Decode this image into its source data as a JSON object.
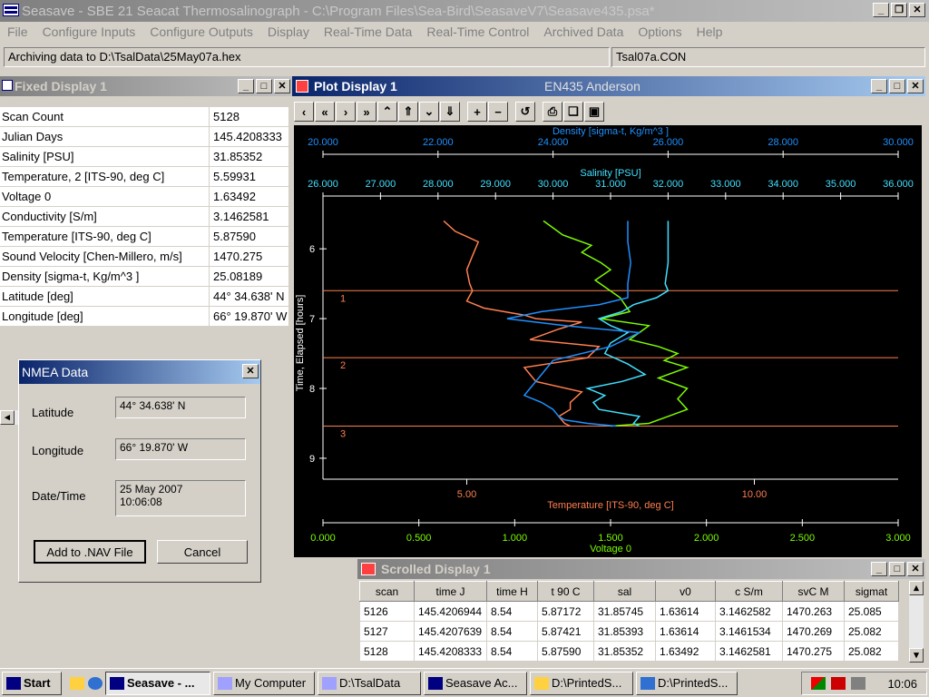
{
  "main_window": {
    "title": "Seasave - SBE 21 Seacat Thermosalinograph - C:\\Program Files\\Sea-Bird\\SeasaveV7\\Seasave435.psa*",
    "menu": [
      "File",
      "Configure Inputs",
      "Configure Outputs",
      "Display",
      "Real-Time Data",
      "Real-Time Control",
      "Archived Data",
      "Options",
      "Help"
    ],
    "archive_status": "Archiving data to D:\\TsalData\\25May07a.hex",
    "con_file": "Tsal07a.CON"
  },
  "fixed_display": {
    "title": "Fixed Display 1",
    "rows": [
      {
        "label": "Scan Count",
        "value": "5128"
      },
      {
        "label": "Julian Days",
        "value": "145.4208333"
      },
      {
        "label": "Salinity [PSU]",
        "value": "31.85352"
      },
      {
        "label": "Temperature, 2 [ITS-90, deg C]",
        "value": "5.59931"
      },
      {
        "label": "Voltage 0",
        "value": "1.63492"
      },
      {
        "label": "Conductivity [S/m]",
        "value": "3.1462581"
      },
      {
        "label": "Temperature [ITS-90, deg C]",
        "value": "5.87590"
      },
      {
        "label": "Sound Velocity [Chen-Millero, m/s]",
        "value": "1470.275"
      },
      {
        "label": "Density [sigma-t, Kg/m^3 ]",
        "value": "25.08189"
      },
      {
        "label": "Latitude [deg]",
        "value": " 44° 34.638' N"
      },
      {
        "label": "Longitude [deg]",
        "value": " 66° 19.870' W"
      }
    ]
  },
  "nmea_dialog": {
    "title": "NMEA Data",
    "latitude_label": "Latitude",
    "latitude_value": "44° 34.638' N",
    "longitude_label": "Longitude",
    "longitude_value": "66° 19.870' W",
    "datetime_label": "Date/Time",
    "date_value": "25 May 2007",
    "time_value": "10:06:08",
    "add_button": "Add to .NAV File",
    "cancel_button": "Cancel"
  },
  "plot_display": {
    "title": "Plot Display 1",
    "subtitle": "EN435 Anderson"
  },
  "chart_data": {
    "type": "line",
    "top_axis_1": {
      "label": "Density [sigma-t, Kg/m^3 ]",
      "ticks": [
        "20.000",
        "22.000",
        "24.000",
        "26.000",
        "28.000",
        "30.000"
      ],
      "range": [
        20,
        30
      ],
      "color": "#1e90ff"
    },
    "top_axis_2": {
      "label": "Salinity [PSU]",
      "ticks": [
        "26.000",
        "27.000",
        "28.000",
        "29.000",
        "30.000",
        "31.000",
        "32.000",
        "33.000",
        "34.000",
        "35.000",
        "36.000"
      ],
      "range": [
        26,
        36
      ],
      "color": "#40e0ff"
    },
    "left_axis": {
      "label": "Time, Elapsed [hours]",
      "ticks": [
        "6",
        "7",
        "8",
        "9"
      ],
      "range": [
        5.4,
        9.3
      ]
    },
    "bottom_axis_1": {
      "label": "Temperature [ITS-90, deg C]",
      "ticks": [
        "5.00",
        "10.00"
      ],
      "range": [
        2.5,
        12.5
      ],
      "color": "#ff7f50"
    },
    "bottom_axis_2": {
      "label": "Voltage 0",
      "ticks": [
        "0.000",
        "0.500",
        "1.000",
        "1.500",
        "2.000",
        "2.500",
        "3.000"
      ],
      "range": [
        0,
        3
      ],
      "color": "#7cfc00"
    },
    "markers": [
      {
        "label": "1",
        "time": 6.6
      },
      {
        "label": "2",
        "time": 7.56
      },
      {
        "label": "3",
        "time": 8.54
      }
    ],
    "series": [
      {
        "color": "#ff7f50",
        "axis": "temperature",
        "x": [
          4.6,
          4.8,
          5.2,
          5.1,
          5.0,
          5.05,
          5.1,
          5.0,
          5.3,
          6.0,
          6.2,
          7.0,
          6.6,
          6.1,
          7.3,
          7.1,
          6.0,
          6.2,
          7.0,
          6.8,
          6.8,
          6.6,
          6.7,
          6.8
        ],
        "y": [
          5.6,
          5.75,
          5.9,
          6.1,
          6.3,
          6.5,
          6.6,
          6.75,
          6.85,
          6.95,
          7.0,
          7.05,
          7.15,
          7.3,
          7.4,
          7.56,
          7.7,
          7.9,
          8.05,
          8.2,
          8.3,
          8.4,
          8.5,
          8.54
        ]
      },
      {
        "color": "#7cfc00",
        "axis": "voltage",
        "x": [
          1.15,
          1.25,
          1.4,
          1.35,
          1.45,
          1.5,
          1.42,
          1.55,
          1.6,
          1.45,
          1.7,
          1.6,
          1.75,
          1.85,
          1.78,
          1.9,
          1.75,
          1.9,
          1.85,
          1.9,
          1.8,
          1.7,
          1.5
        ],
        "y": [
          5.6,
          5.8,
          5.95,
          6.05,
          6.2,
          6.3,
          6.45,
          6.7,
          6.9,
          7.0,
          7.1,
          7.3,
          7.4,
          7.5,
          7.6,
          7.7,
          7.85,
          8.0,
          8.15,
          8.3,
          8.4,
          8.5,
          8.54
        ]
      },
      {
        "color": "#40e0ff",
        "axis": "salinity",
        "x": [
          32.0,
          32.0,
          32.0,
          31.95,
          32.0,
          31.8,
          31.4,
          31.2,
          30.8,
          31.0,
          31.3,
          31.0,
          30.9,
          31.3,
          31.6,
          31.2,
          30.6,
          30.9,
          30.7,
          30.8,
          31.5,
          31.4,
          31.5
        ],
        "y": [
          5.6,
          5.9,
          6.2,
          6.5,
          6.6,
          6.7,
          6.8,
          6.9,
          7.0,
          7.1,
          7.2,
          7.35,
          7.5,
          7.65,
          7.8,
          7.9,
          8.0,
          8.1,
          8.2,
          8.3,
          8.4,
          8.5,
          8.54
        ]
      },
      {
        "color": "#1e90ff",
        "axis": "density",
        "x": [
          25.3,
          25.3,
          25.35,
          25.3,
          25.3,
          25.3,
          24.8,
          23.8,
          23.2,
          24.2,
          25.5,
          25.0,
          24.0,
          23.8,
          23.6,
          23.5,
          23.8,
          24.0,
          24.1,
          24.2,
          24.6,
          25.1
        ],
        "y": [
          5.6,
          5.9,
          6.2,
          6.5,
          6.6,
          6.7,
          6.8,
          6.9,
          7.0,
          7.1,
          7.2,
          7.4,
          7.6,
          7.8,
          8.0,
          8.1,
          8.2,
          8.3,
          8.4,
          8.45,
          8.5,
          8.54
        ]
      }
    ]
  },
  "scrolled_display": {
    "title": "Scrolled Display 1",
    "columns": [
      "scan",
      "time J",
      "time H",
      "t 90 C",
      "sal",
      "v0",
      "c S/m",
      "svC M",
      "sigmat"
    ],
    "rows": [
      [
        "5126",
        "145.4206944",
        "8.54",
        "5.87172",
        "31.85745",
        "1.63614",
        "3.1462582",
        "1470.263",
        "25.085"
      ],
      [
        "5127",
        "145.4207639",
        "8.54",
        "5.87421",
        "31.85393",
        "1.63614",
        "3.1461534",
        "1470.269",
        "25.082"
      ],
      [
        "5128",
        "145.4208333",
        "8.54",
        "5.87590",
        "31.85352",
        "1.63492",
        "3.1462581",
        "1470.275",
        "25.082"
      ]
    ]
  },
  "taskbar": {
    "start": "Start",
    "items": [
      "Seasave - ...",
      "My Computer",
      "D:\\TsalData",
      "Seasave Ac...",
      "D:\\PrintedS...",
      "D:\\PrintedS..."
    ],
    "clock": "10:06"
  }
}
